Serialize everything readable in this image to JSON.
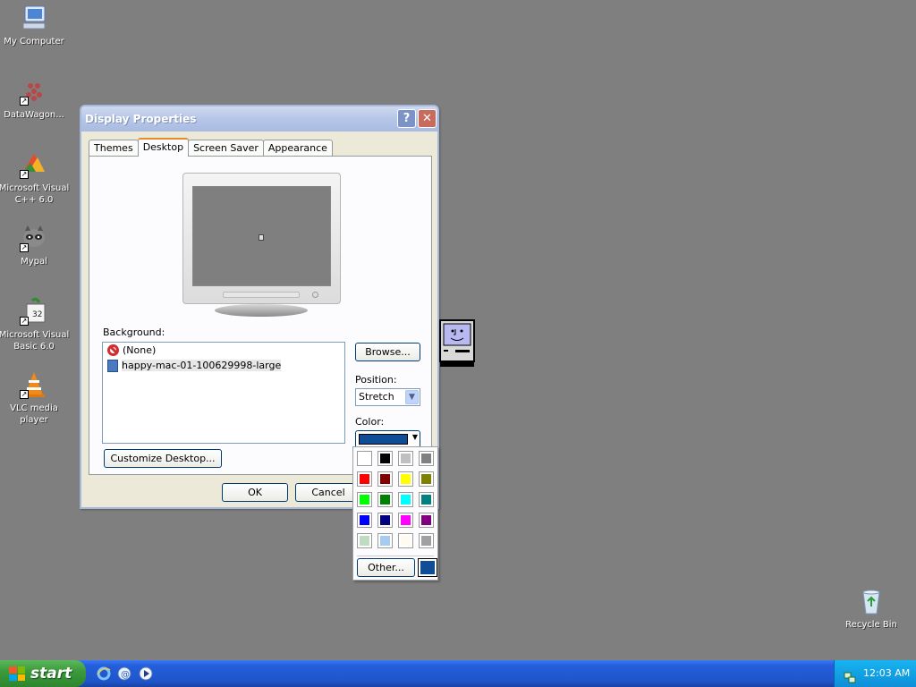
{
  "desktop": {
    "background_color": "#7f7f7f",
    "icons": [
      {
        "label": "My Computer",
        "icon": "computer-icon"
      },
      {
        "label": "DataWagon...",
        "icon": "datawagon-icon"
      },
      {
        "label": "Microsoft Visual C++ 6.0",
        "icon": "visual-cpp-icon"
      },
      {
        "label": "Mypal",
        "icon": "raccoon-browser-icon"
      },
      {
        "label": "Microsoft Visual Basic 6.0",
        "icon": "visual-basic-icon"
      },
      {
        "label": "VLC media player",
        "icon": "vlc-cone-icon"
      },
      {
        "label": "Recycle Bin",
        "icon": "recycle-bin-icon"
      }
    ]
  },
  "window": {
    "title": "Display Properties",
    "help_label": "?",
    "close_label": "✕",
    "tabs": [
      {
        "label": "Themes",
        "active": false
      },
      {
        "label": "Desktop",
        "active": true
      },
      {
        "label": "Screen Saver",
        "active": false
      },
      {
        "label": "Appearance",
        "active": false
      }
    ],
    "background_label": "Background:",
    "background_items": [
      {
        "label": "(None)",
        "icon": "none-icon",
        "selected": false
      },
      {
        "label": "happy-mac-01-100629998-large",
        "icon": "image-file-icon",
        "selected": true
      }
    ],
    "browse_label": "Browse...",
    "position_label": "Position:",
    "position_value": "Stretch",
    "color_label": "Color:",
    "selected_color": "#0f4e97",
    "customize_label": "Customize Desktop...",
    "ok_label": "OK",
    "cancel_label": "Cancel"
  },
  "color_popup": {
    "colors": [
      "#ffffff",
      "#000000",
      "#c0c0c0",
      "#808080",
      "#ff0000",
      "#800000",
      "#ffff00",
      "#808000",
      "#00ff00",
      "#008000",
      "#00ffff",
      "#008080",
      "#0000ff",
      "#000080",
      "#ff00ff",
      "#800080",
      "#c0dcc0",
      "#a6caf0",
      "#fffbf0",
      "#a0a0a4"
    ],
    "other_label": "Other...",
    "current_color": "#0f4e97"
  },
  "taskbar": {
    "start_label": "start",
    "quick_launch": [
      "internet-explorer-icon",
      "outlook-express-icon",
      "media-player-icon"
    ],
    "clock": "12:03 AM"
  }
}
